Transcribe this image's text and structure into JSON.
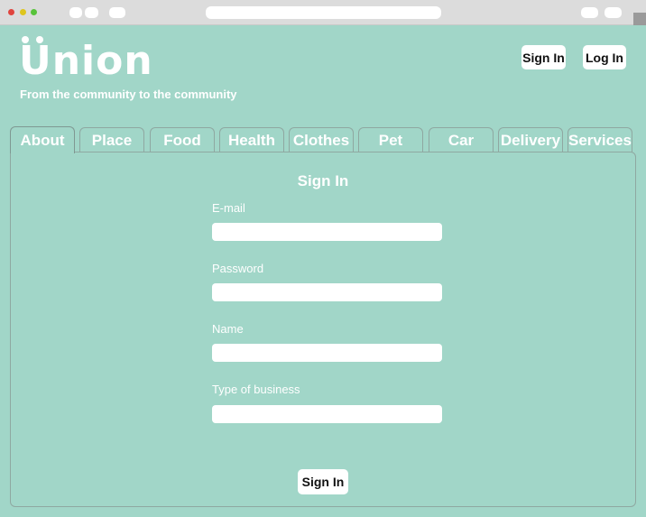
{
  "browser": {
    "traffic_lights": [
      "#e0443e",
      "#dec51e",
      "#58c33a"
    ]
  },
  "header": {
    "logo_text": "Union",
    "tagline": "From the community to the community",
    "signin_label": "Sign In",
    "login_label": "Log In"
  },
  "tabs": [
    {
      "label": "About",
      "active": true
    },
    {
      "label": "Place"
    },
    {
      "label": "Food"
    },
    {
      "label": "Health"
    },
    {
      "label": "Clothes"
    },
    {
      "label": "Pet"
    },
    {
      "label": "Car"
    },
    {
      "label": "Delivery"
    },
    {
      "label": "Services"
    }
  ],
  "form": {
    "title": "Sign In",
    "fields": [
      {
        "label": "E-mail",
        "value": ""
      },
      {
        "label": "Password",
        "value": ""
      },
      {
        "label": "Name",
        "value": ""
      },
      {
        "label": "Type of business",
        "value": ""
      }
    ],
    "submit_label": "Sign In"
  },
  "colors": {
    "background": "#a1d6c8",
    "text": "#ffffff",
    "button_bg": "#ffffff"
  }
}
